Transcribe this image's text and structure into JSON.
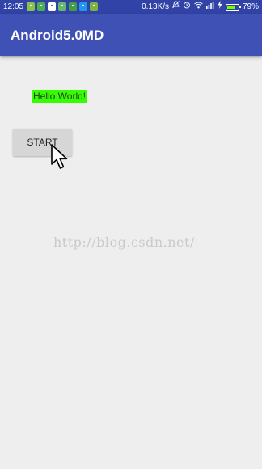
{
  "status_bar": {
    "time": "12:05",
    "network_speed": "0.13K/s",
    "battery_percent": "79%",
    "battery_level": 0.79,
    "notification_icons": [
      "app-icon",
      "app-icon",
      "app-icon",
      "app-icon",
      "app-icon",
      "app-icon",
      "app-icon"
    ],
    "status_icons": [
      "silent-icon",
      "alarm-icon",
      "wifi-icon",
      "signal-icon",
      "charging-icon",
      "battery-icon"
    ]
  },
  "toolbar": {
    "title": "Android5.0MD"
  },
  "main": {
    "hello_text": "Hello World!",
    "start_label": "START"
  },
  "watermark": {
    "text": "http://blog.csdn.net/"
  },
  "colors": {
    "primary": "#3F51B5",
    "primary_dark": "#3243A8",
    "hello_bg": "#33FF00",
    "button_bg": "#D6D6D6",
    "background": "#EEEEEE"
  }
}
